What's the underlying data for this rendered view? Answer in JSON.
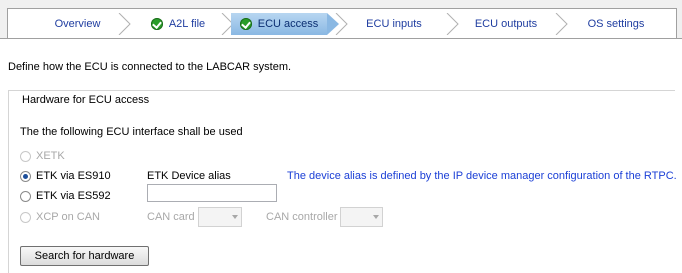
{
  "wizard": {
    "steps": [
      {
        "label": "Overview",
        "state": "normal",
        "check": false
      },
      {
        "label": "A2L file",
        "state": "normal",
        "check": true
      },
      {
        "label": "ECU access",
        "state": "active",
        "check": true
      },
      {
        "label": "ECU inputs",
        "state": "normal",
        "check": false
      },
      {
        "label": "ECU outputs",
        "state": "normal",
        "check": false
      },
      {
        "label": "OS settings",
        "state": "normal",
        "check": false
      }
    ],
    "active_color": "#8ab8e3",
    "link_color": "#1f3da0"
  },
  "page": {
    "description": "Define how the ECU is connected to the LABCAR system."
  },
  "group": {
    "title": "Hardware for ECU access",
    "instruction": "The the following ECU interface shall be used",
    "options": [
      {
        "label": "XETK",
        "enabled": false,
        "checked": false
      },
      {
        "label": "ETK via ES910",
        "enabled": true,
        "checked": true
      },
      {
        "label": "ETK via ES592",
        "enabled": true,
        "checked": false
      },
      {
        "label": "XCP on CAN",
        "enabled": false,
        "checked": false
      }
    ],
    "etk_device_alias_label": "ETK Device alias",
    "etk_device_alias_value": "",
    "alias_note": "The device alias is defined by the IP device manager configuration of the RTPC.",
    "can_card_label": "CAN card",
    "can_card_value": "",
    "can_controller_label": "CAN controller",
    "can_controller_value": "",
    "search_button": "Search for hardware"
  }
}
